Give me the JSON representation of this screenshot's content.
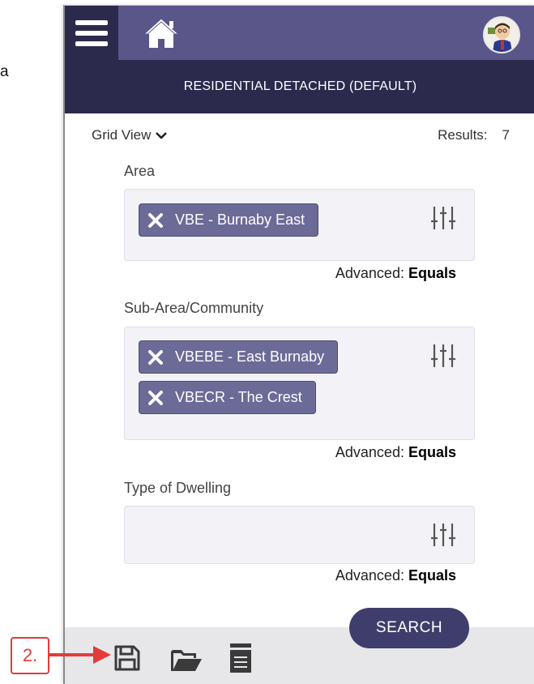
{
  "stray_text": "a",
  "header": {
    "menu_icon": "hamburger-menu-icon",
    "home_icon": "home-icon",
    "avatar_icon": "user-avatar",
    "subtitle": "RESIDENTIAL DETACHED (DEFAULT)"
  },
  "toolbar": {
    "view_label": "Grid View",
    "results_label": "Results:",
    "results_count": "7"
  },
  "fields": {
    "area": {
      "label": "Area",
      "chips": [
        "VBE - Burnaby East"
      ],
      "advanced_label": "Advanced:",
      "advanced_value": "Equals"
    },
    "subarea": {
      "label": "Sub-Area/Community",
      "chips": [
        "VBEBE - East Burnaby",
        "VBECR - The Crest"
      ],
      "advanced_label": "Advanced:",
      "advanced_value": "Equals"
    },
    "dwelling": {
      "label": "Type of Dwelling",
      "chips": [],
      "advanced_label": "Advanced:",
      "advanced_value": "Equals"
    }
  },
  "actions": {
    "search_label": "SEARCH",
    "save_icon": "save-icon",
    "open_icon": "folder-open-icon",
    "list_icon": "document-list-icon"
  },
  "annotation": {
    "callout_label": "2."
  },
  "colors": {
    "header_bg": "#5a5689",
    "header_dark": "#2c2a4c",
    "chip_bg": "#6c6a97",
    "search_bg": "#3f3d6b",
    "callout_red": "#e33b3b"
  }
}
